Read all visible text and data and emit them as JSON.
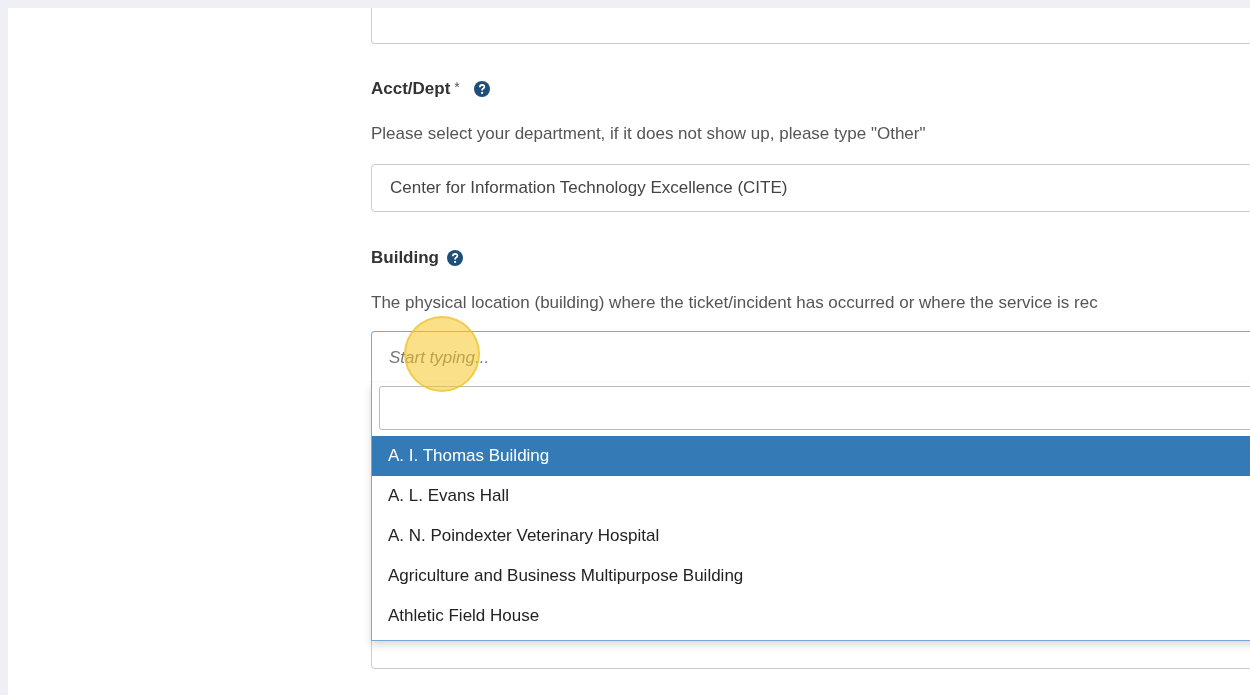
{
  "fields": [
    {
      "label": "Acct/Dept",
      "required_mark": "*",
      "help": "Please select your department, if it does not show up, please type \"Other\"",
      "value": "Center for Information Technology Excellence (CITE)"
    },
    {
      "label": "Building",
      "help": "The physical location (building) where the ticket/incident has occurred or where the service is rec",
      "placeholder": "Start typing...",
      "dropdown_open": true,
      "options": [
        {
          "label": "A. I. Thomas Building",
          "selected": true
        },
        {
          "label": "A. L. Evans Hall",
          "selected": false
        },
        {
          "label": "A. N. Poindexter Veterinary Hospital",
          "selected": false
        },
        {
          "label": "Agriculture and Business Multipurpose Building",
          "selected": false
        },
        {
          "label": "Athletic Field House",
          "selected": false
        }
      ]
    }
  ]
}
